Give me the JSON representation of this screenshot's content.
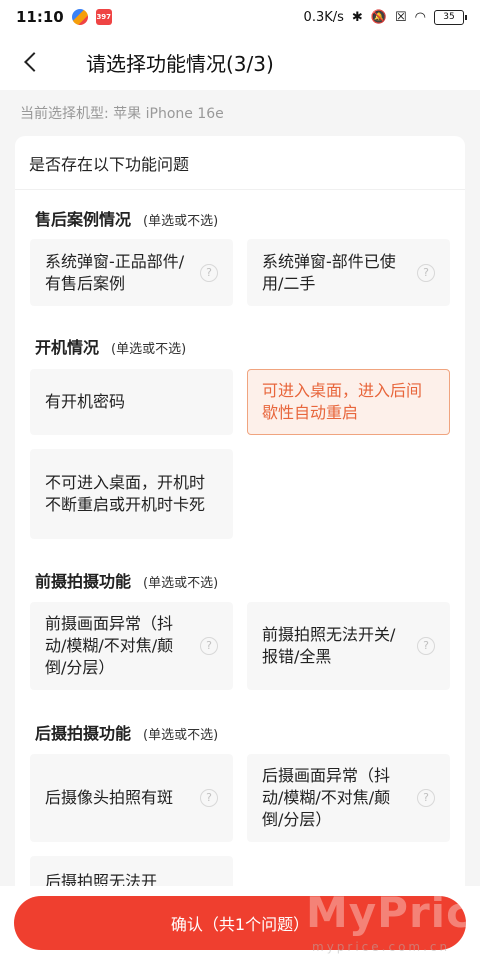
{
  "status_bar": {
    "time": "11:10",
    "app_badge": "397",
    "network_speed": "0.3K/s",
    "battery": "35"
  },
  "header": {
    "title": "请选择功能情况(3/3)"
  },
  "model_line": "当前选择机型: 苹果 iPhone 16e",
  "card_title": "是否存在以下功能问题",
  "sections": [
    {
      "title": "售后案例情况",
      "hint": "(单选或不选)",
      "options": [
        {
          "label": "系统弹窗-正品部件/有售后案例",
          "selected": false,
          "help": "?"
        },
        {
          "label": "系统弹窗-部件已使用/二手",
          "selected": false,
          "help": "?"
        }
      ]
    },
    {
      "title": "开机情况",
      "hint": "(单选或不选)",
      "options": [
        {
          "label": "有开机密码",
          "selected": false
        },
        {
          "label": "可进入桌面，进入后间歇性自动重启",
          "selected": true
        },
        {
          "label": "不可进入桌面，开机时不断重启或开机时卡死",
          "selected": false
        }
      ]
    },
    {
      "title": "前摄拍摄功能",
      "hint": "(单选或不选)",
      "options": [
        {
          "label": "前摄画面异常（抖动/模糊/不对焦/颠倒/分层）",
          "selected": false,
          "help": "?"
        },
        {
          "label": "前摄拍照无法开关/报错/全黑",
          "selected": false,
          "help": "?"
        }
      ]
    },
    {
      "title": "后摄拍摄功能",
      "hint": "(单选或不选)",
      "options": [
        {
          "label": "后摄像头拍照有斑",
          "selected": false,
          "help": "?"
        },
        {
          "label": "后摄画面异常（抖动/模糊/不对焦/颠倒/分层）",
          "selected": false,
          "help": "?"
        },
        {
          "label": "后摄拍照无法开",
          "selected": false
        }
      ]
    }
  ],
  "confirm_button": "确认（共1个问题）",
  "watermark": {
    "main": "MyPrice",
    "sub": "myprice.com.cn"
  },
  "colors": {
    "accent": "#ef3f2f",
    "selected_text": "#e8663c",
    "selected_bg": "#fdf0ea"
  }
}
